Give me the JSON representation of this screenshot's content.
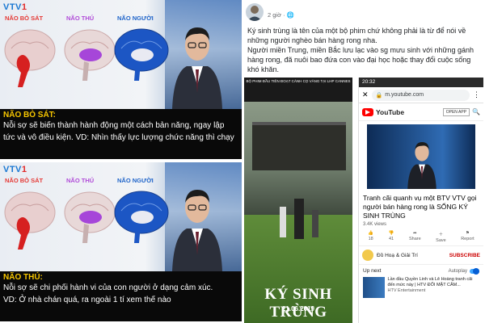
{
  "tv_panels": [
    {
      "logo_a": "VTV",
      "logo_b": "1",
      "brain_labels": [
        "NÃO BÒ SÁT",
        "NÃO THÚ",
        "NÃO NGƯỜI"
      ],
      "heading": "NÃO BÒ SÁT:",
      "lines": [
        "Nỗi sợ sẽ biến thành hành động một cách bản năng, ngay lập",
        "tức và vô điều kiện. VD: Nhìn thấy lực lượng chức năng thì chạy"
      ]
    },
    {
      "logo_a": "VTV",
      "logo_b": "1",
      "brain_labels": [
        "NÃO BÒ SÁT",
        "NÃO THÚ",
        "NÃO NGƯỜI"
      ],
      "heading": "NÃO THÚ:",
      "lines": [
        "Nỗi sợ sẽ chi phối hành vi của con người ở dạng cảm xúc.",
        "VD: Ở nhà chán quá, ra ngoài 1 tí xem thế nào"
      ]
    }
  ],
  "colors": {
    "brain_label_1": "#e53935",
    "brain_label_2": "#b04ad8",
    "brain_label_3": "#1e63c9",
    "caption_heading": "#f7c600"
  },
  "post": {
    "time": "2 giờ",
    "time_icon": "globe-icon",
    "text_1": "Ký sinh trùng là tên của một bộ phim chứ không phải là từ để nói về những người nghèo bán hàng rong nha.",
    "text_2": "Người miền Trung, miền Bắc lưu lạc vào sg mưu sinh với những gánh hàng rong, đã nuôi bao đứa con vào đại học hoặc thay đổi cuộc sống khó khăn."
  },
  "poster": {
    "cannes": "BỘ PHIM ĐẦU TIÊN ĐOẠT CÀNH CỌ VÀNG TẠI LHP CANNES",
    "title": "KÝ SINH TRÙNG",
    "date": "21.06.2019"
  },
  "phone": {
    "time": "20:32",
    "url": "m.youtube.com",
    "yt_name": "YouTube",
    "open_app": "OPEN APP",
    "video_title": "Tranh cãi quanh vụ một BTV VTV gọi người bán hàng rong là SỐNG KÝ SINH TRÙNG",
    "views": "3.4K views",
    "actions": [
      {
        "icon": "thumb-up-icon",
        "label": "18"
      },
      {
        "icon": "thumb-down-icon",
        "label": "41"
      },
      {
        "icon": "share-icon",
        "label": "Share"
      },
      {
        "icon": "save-icon",
        "label": "Save"
      },
      {
        "icon": "flag-icon",
        "label": "Report"
      }
    ],
    "channel": "Đồ Hoạ & Giải Trí",
    "subscribe": "SUBSCRIBE",
    "up_next": "Up next",
    "autoplay": "Autoplay",
    "next_title": "Lần đầu Quyền Linh và Lê Hoàng tranh cãi đến mức này | HTV ĐỐI MẶT CĂM...",
    "next_channel": "HTV Entertainment"
  }
}
